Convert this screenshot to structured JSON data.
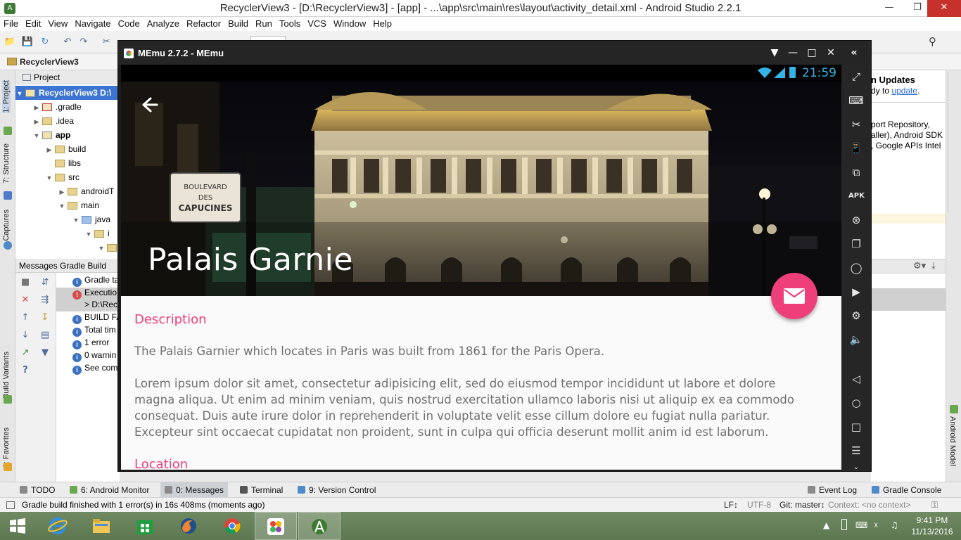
{
  "ide": {
    "window_title": "RecyclerView3 - [D:\\RecyclerView3] - [app] - ...\\app\\src\\main\\res\\layout\\activity_detail.xml - Android Studio 2.2.1",
    "menu": [
      "File",
      "Edit",
      "View",
      "Navigate",
      "Code",
      "Analyze",
      "Refactor",
      "Build",
      "Run",
      "Tools",
      "VCS",
      "Window",
      "Help"
    ],
    "breadcrumb": "RecyclerView3",
    "left_stripe": [
      "1: Project",
      "7: Structure",
      "Captures",
      "Build Variants",
      "2: Favorites"
    ],
    "right_stripe": [
      "Android Model"
    ],
    "project_panel": {
      "header": "Project",
      "rows": [
        "RecyclerView3 D:\\",
        ".gradle",
        ".idea",
        "app",
        "build",
        "libs",
        "src",
        "androidT",
        "main",
        "java",
        "i",
        ""
      ]
    },
    "messages": {
      "header": "Messages Gradle Build",
      "rows": [
        "Gradle ta",
        "Executio",
        "> D:\\Rec",
        "BUILD FA",
        "Total tim",
        "1 error",
        "0 warnin",
        "See com"
      ]
    },
    "right_panel": {
      "updates_title": "n Updates",
      "updates_text_prefix": "dy to ",
      "updates_link": "update",
      "updates_text_suffix": ".",
      "body_lines": [
        "port Repository,",
        "aller), Android SDK",
        ", Google APIs Intel"
      ]
    },
    "bottom_tabs": [
      "TODO",
      "6: Android Monitor",
      "0: Messages",
      "Terminal",
      "9: Version Control",
      "Event Log",
      "Gradle Console"
    ],
    "status": {
      "message": "Gradle build finished with 1 error(s) in 16s 408ms (moments ago)",
      "line_sep": "LF↕",
      "encoding": "UTF-8",
      "git": "Git: master↕",
      "context": "Context: <no context>"
    }
  },
  "emulator": {
    "title": "MEmu 2.7.2 - MEmu",
    "clock": "21:59",
    "hero_title": "Palais Garnie",
    "sections": [
      {
        "heading": "Description",
        "text": "The Palais Garnier which locates in Paris was built from 1861 for the Paris Opera."
      },
      {
        "heading": "",
        "text": "Lorem ipsum dolor sit amet, consectetur adipisicing elit, sed do eiusmod tempor incididunt ut labore et dolore magna aliqua. Ut enim ad minim veniam, quis nostrud exercitation ullamco laboris nisi ut aliquip ex ea commodo consequat. Duis aute irure dolor in reprehenderit in voluptate velit esse cillum dolore eu fugiat nulla pariatur. Excepteur sint occaecat cupidatat non proident, sunt in culpa qui officia deserunt mollit anim id est laborum."
      },
      {
        "heading": "Location",
        "text": ""
      }
    ],
    "sign_lines": [
      "BOULEVARD",
      "DES",
      "CAPUCINES"
    ],
    "accent_color": "#ef3f7b"
  },
  "taskbar": {
    "time": "9:41 PM",
    "date": "11/13/2016"
  }
}
